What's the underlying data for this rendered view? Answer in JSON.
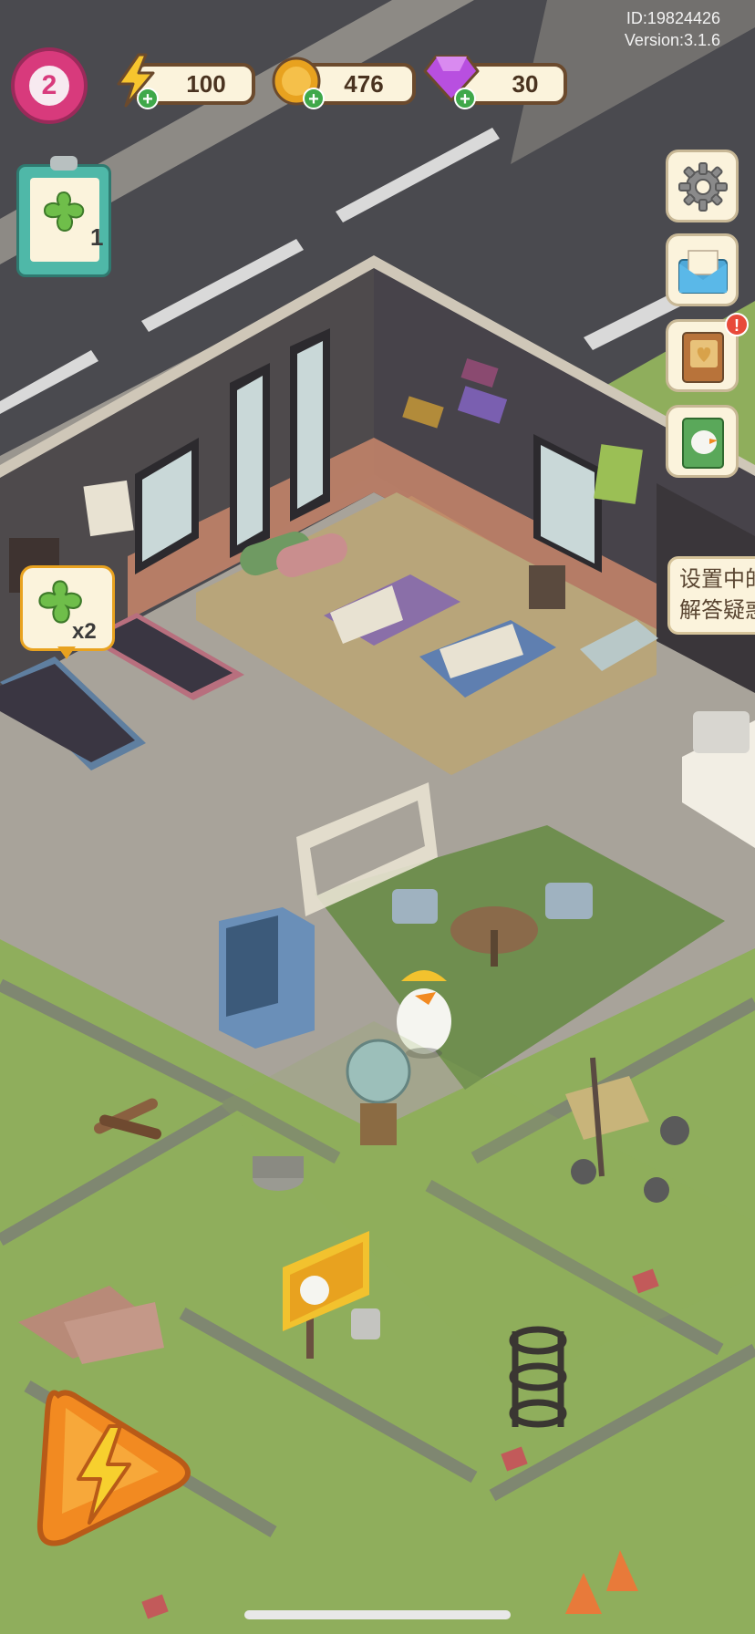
{
  "hud": {
    "level": "2",
    "energy": "100",
    "coins": "476",
    "gems": "30",
    "plus_symbol": "+",
    "player_id": "ID:19824426",
    "version": "Version:3.1.6"
  },
  "quest": {
    "count": "1"
  },
  "clover_bubble": {
    "multiplier": "x2"
  },
  "side_menu": {
    "icons": [
      "gear-icon",
      "mail-icon",
      "book-icon",
      "album-icon"
    ],
    "notification_mark": "!"
  },
  "tooltip": {
    "line1": "设置中的",
    "line2": "解答疑惑"
  },
  "colors": {
    "level_badge": "#d83a7c",
    "energy": "#f7c52e",
    "coin": "#e8a21f",
    "gem": "#b84fe0",
    "plus": "#3fa84a",
    "grass": "#8fae5c",
    "road": "#4a4a4f",
    "floor": "#a8a39a",
    "wall": "#4e4a4c",
    "brick": "#c9866b",
    "boost_button": "#f28a21"
  }
}
